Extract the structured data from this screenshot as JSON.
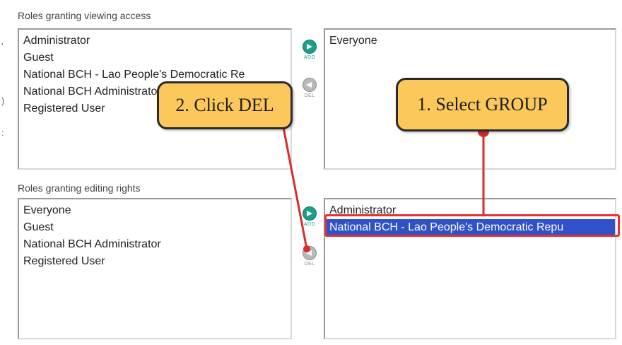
{
  "viewing": {
    "label": "Roles granting viewing access",
    "available_roles": [
      "Administrator",
      "Guest",
      "National BCH - Lao People's Democratic Re",
      "National BCH Administrator",
      "Registered User"
    ],
    "granted_roles": [
      "Everyone"
    ],
    "add_label": "ADD",
    "del_label": "DEL"
  },
  "editing": {
    "label": "Roles granting editing rights",
    "available_roles": [
      "Everyone",
      "Guest",
      "National BCH Administrator",
      "Registered User"
    ],
    "granted_roles": [
      "Administrator",
      "National BCH - Lao People's Democratic Repu"
    ],
    "selected_index": 1,
    "add_label": "ADD",
    "del_label": "DEL"
  },
  "annotations": {
    "step1": "1. Select GROUP",
    "step2": "2. Click DEL",
    "callout_color": "#fcc85b",
    "line_color": "#d92b2b"
  }
}
